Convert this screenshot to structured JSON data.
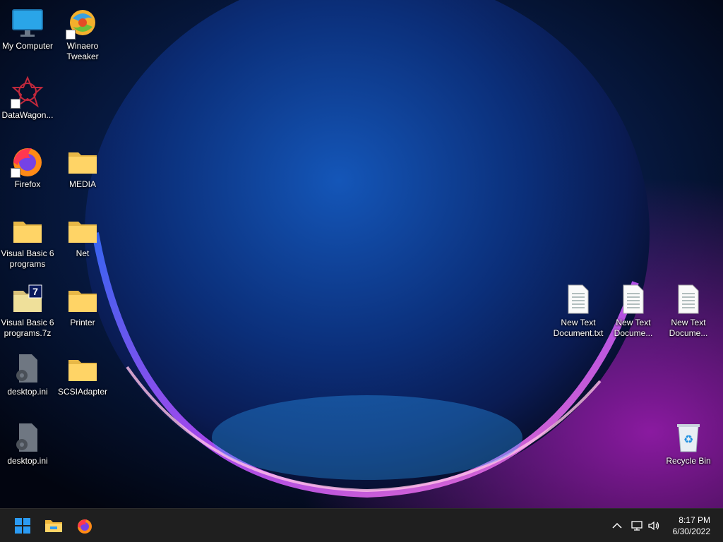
{
  "desktop": {
    "icons": [
      {
        "id": "my-computer",
        "label": "My Computer"
      },
      {
        "id": "winaero-tweaker",
        "label": "Winaero Tweaker"
      },
      {
        "id": "datawagon",
        "label": "DataWagon..."
      },
      {
        "id": "firefox",
        "label": "Firefox"
      },
      {
        "id": "media",
        "label": "MEDIA"
      },
      {
        "id": "vb6-programs",
        "label": "Visual Basic 6 programs"
      },
      {
        "id": "net",
        "label": "Net"
      },
      {
        "id": "vb6-programs-7z",
        "label": "Visual Basic 6 programs.7z"
      },
      {
        "id": "printer",
        "label": "Printer"
      },
      {
        "id": "desktop-ini-1",
        "label": "desktop.ini"
      },
      {
        "id": "scsiadapter",
        "label": "SCSIAdapter"
      },
      {
        "id": "desktop-ini-2",
        "label": "desktop.ini"
      },
      {
        "id": "new-text-1",
        "label": "New Text Document.txt"
      },
      {
        "id": "new-text-2",
        "label": "New Text Docume..."
      },
      {
        "id": "new-text-3",
        "label": "New Text Docume..."
      },
      {
        "id": "recycle-bin",
        "label": "Recycle Bin"
      }
    ]
  },
  "taskbar": {
    "pinned": [
      "start-icon",
      "file-explorer-icon",
      "firefox-icon"
    ],
    "tray": [
      "chevron-up-icon",
      "network-icon",
      "volume-icon"
    ],
    "clock": {
      "time": "8:17 PM",
      "date": "6/30/2022"
    }
  },
  "colors": {
    "taskbar": "#1f1f1f",
    "accent": "#0078d4"
  }
}
